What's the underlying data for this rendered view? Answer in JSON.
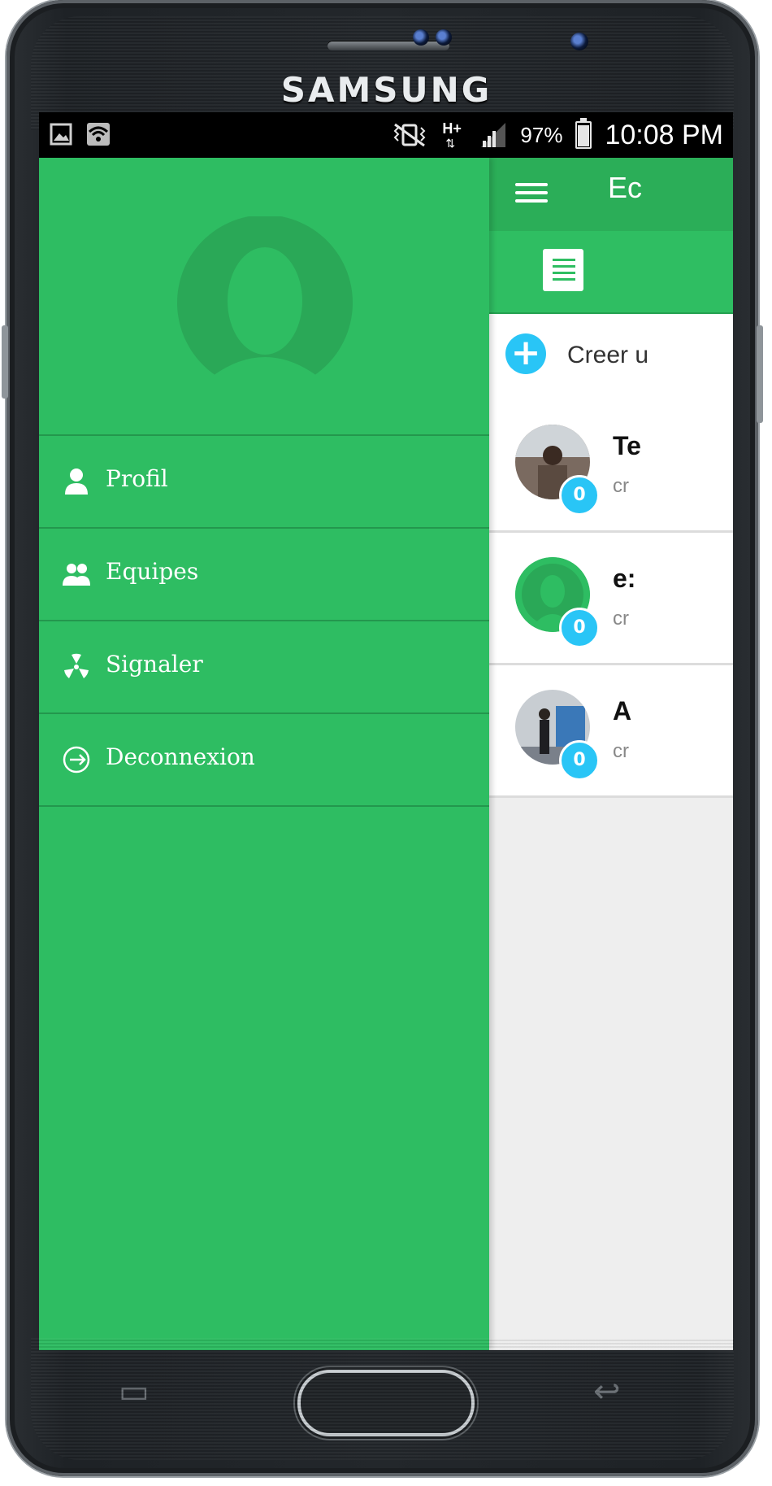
{
  "device": {
    "brand": "SAMSUNG"
  },
  "statusbar": {
    "left_icons": [
      "image-icon",
      "wifi-icon"
    ],
    "network": "H+",
    "battery": "97%",
    "time": "10:08 PM"
  },
  "appbar": {
    "title": "Ec"
  },
  "tabs": [
    {
      "icon": "document-list-icon"
    }
  ],
  "create": {
    "label": "Creer u"
  },
  "teams": [
    {
      "name": "Te",
      "subtitle": "cr",
      "badge": "0",
      "avatar": "photo"
    },
    {
      "name": "e:",
      "subtitle": "cr",
      "badge": "0",
      "avatar": "default-user"
    },
    {
      "name": "A",
      "subtitle": "cr",
      "badge": "0",
      "avatar": "photo"
    }
  ],
  "drawer": {
    "menu": [
      {
        "label": "Profil",
        "icon": "user-icon"
      },
      {
        "label": "Equipes",
        "icon": "users-icon"
      },
      {
        "label": "Signaler",
        "icon": "radiation-icon"
      },
      {
        "label": "Deconnexion",
        "icon": "logout-icon"
      }
    ]
  },
  "colors": {
    "primary": "#2ebd62",
    "primary_dark": "#2bae58",
    "accent": "#29c5f6"
  }
}
